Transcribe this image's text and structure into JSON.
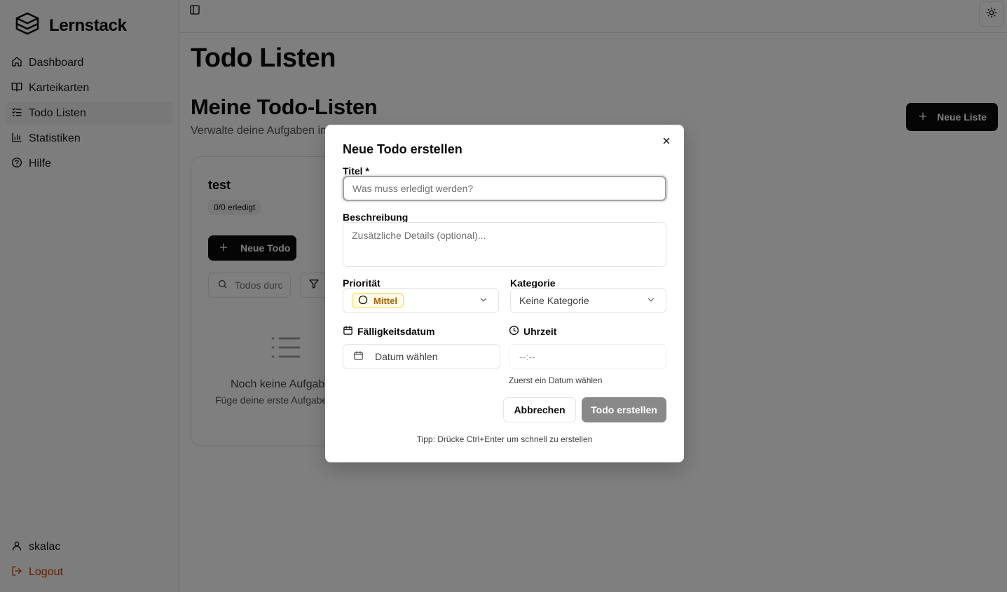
{
  "app": {
    "name": "Lernstack"
  },
  "sidebar": {
    "items": [
      {
        "label": "Dashboard",
        "icon": "home-icon"
      },
      {
        "label": "Karteikarten",
        "icon": "book-open-icon"
      },
      {
        "label": "Todo Listen",
        "icon": "list-todo-icon",
        "active": true
      },
      {
        "label": "Statistiken",
        "icon": "bar-chart-icon"
      },
      {
        "label": "Hilfe",
        "icon": "help-circle-icon"
      }
    ],
    "user": "skalac",
    "logout": "Logout"
  },
  "page": {
    "title": "Todo Listen",
    "section_title": "Meine Todo-Listen",
    "section_sub": "Verwalte deine Aufgaben in",
    "new_list_label": "Neue Liste"
  },
  "list_card": {
    "title": "test",
    "badge": "0/0 erledigt",
    "new_todo_label": "Neue Todo",
    "search_placeholder": "Todos durc",
    "empty_title": "Noch keine Aufgab",
    "empty_sub": "Füge deine erste Aufgabe"
  },
  "dialog": {
    "title": "Neue Todo erstellen",
    "title_label": "Titel *",
    "title_placeholder": "Was muss erledigt werden?",
    "description_label": "Beschreibung",
    "description_placeholder": "Zusätzliche Details (optional)...",
    "priority_label": "Priorität",
    "priority_value": "Mittel",
    "category_label": "Kategorie",
    "category_value": "Keine Kategorie",
    "due_label": "Fälligkeitsdatum",
    "due_placeholder": "Datum wählen",
    "time_label": "Uhrzeit",
    "time_placeholder": "--:--",
    "time_hint": "Zuerst ein Datum wählen",
    "cancel_label": "Abbrechen",
    "create_label": "Todo erstellen",
    "tip": "Tipp: Drücke Ctrl+Enter um schnell zu erstellen"
  },
  "colors": {
    "overlay": "rgba(0,0,0,0.5)",
    "primary": "#0a0a0a",
    "logout": "#c2410c",
    "priority_bg": "#fefce8",
    "priority_text": "#a16207"
  }
}
